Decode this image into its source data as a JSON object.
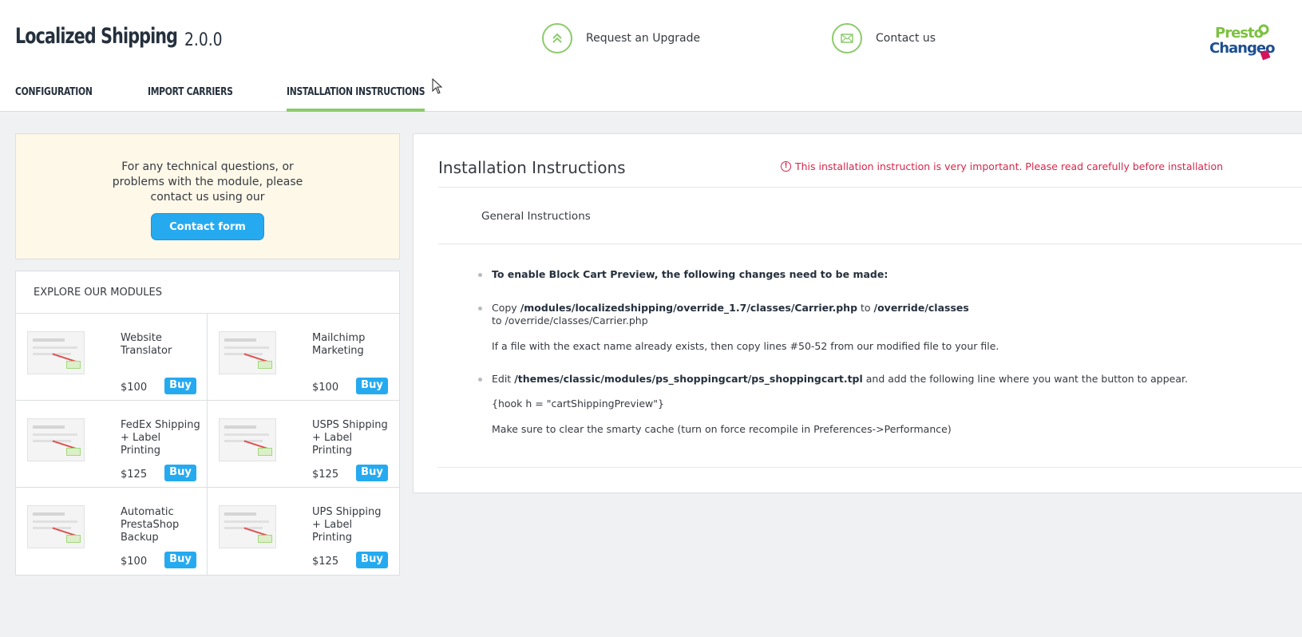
{
  "header": {
    "title": "Localized Shipping",
    "version": "2.0.0",
    "upgrade_label": "Request an Upgrade",
    "contact_label": "Contact us",
    "logo_text": "Presto Changeo"
  },
  "tabs": [
    {
      "label": "CONFIGURATION"
    },
    {
      "label": "IMPORT CARRIERS"
    },
    {
      "label": "INSTALLATION INSTRUCTIONS",
      "active": true
    }
  ],
  "support": {
    "text": "For any technical questions, or problems with the module, please contact us using our",
    "button": "Contact form"
  },
  "modules": {
    "heading": "EXPLORE OUR MODULES",
    "items": [
      {
        "name": "Website Translator",
        "price": "$100",
        "buy": "Buy"
      },
      {
        "name": "Mailchimp Marketing",
        "price": "$100",
        "buy": "Buy"
      },
      {
        "name": "FedEx Shipping + Label Printing",
        "price": "$125",
        "buy": "Buy"
      },
      {
        "name": "USPS Shipping + Label Printing",
        "price": "$125",
        "buy": "Buy"
      },
      {
        "name": "Automatic PrestaShop Backup",
        "price": "$100",
        "buy": "Buy"
      },
      {
        "name": "UPS Shipping + Label Printing",
        "price": "$125",
        "buy": "Buy"
      }
    ]
  },
  "instructions": {
    "title": "Installation Instructions",
    "warning": "This installation instruction is very important. Please read carefully before installation",
    "section": "General Instructions",
    "step1": "To enable Block Cart Preview, the following changes need to be made:",
    "step2_pre": "Copy ",
    "step2_src": "/modules/localizedshipping/override_1.7/classes/Carrier.php",
    "step2_mid": " to ",
    "step2_dst": "/override/classes",
    "step2_line2": "to /override/classes/Carrier.php",
    "step2_note": "If a file with the exact name already exists, then copy lines #50-52 from our modified file to your file.",
    "step3_pre": "Edit ",
    "step3_file": "/themes/classic/modules/ps_shoppingcart/ps_shoppingcart.tpl",
    "step3_post": " and add the following line where you want the button to appear.",
    "step3_code": "{hook h = \"cartShippingPreview\"}",
    "step3_note": "Make sure to clear the smarty cache (turn on force recompile in Preferences->Performance)"
  },
  "colors": {
    "accent_green": "#8ccb6b",
    "button_blue": "#25aaf0",
    "warning_red": "#d6264a"
  }
}
